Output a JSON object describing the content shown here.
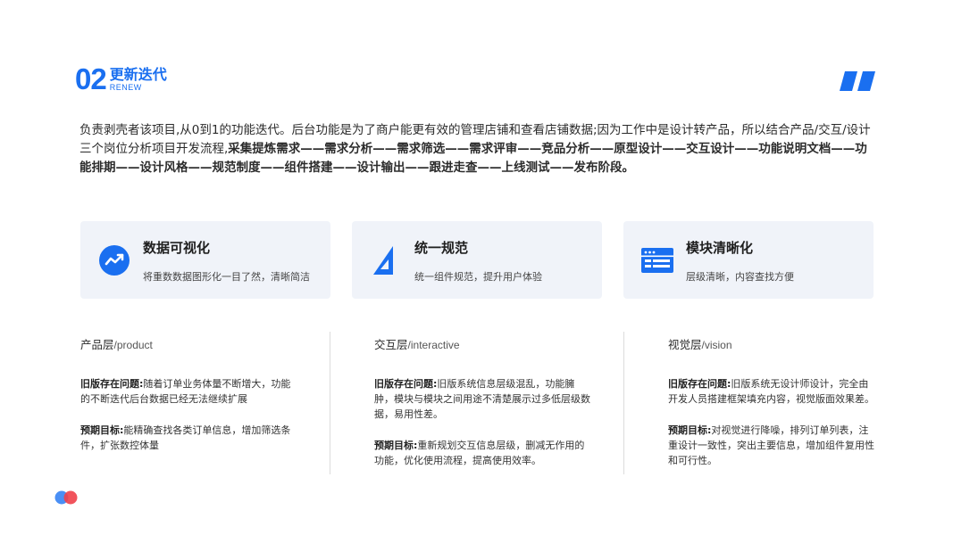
{
  "header": {
    "number": "02",
    "title": "更新迭代",
    "subtitle": "RENEW"
  },
  "intro": {
    "text": "负责剥壳者该项目,从0到1的功能迭代。后台功能是为了商户能更有效的管理店铺和查看店铺数据;因为工作中是设计转产品，所以结合产品/交互/设计三个岗位分析项目开发流程,",
    "flow": "采集提炼需求——需求分析——需求筛选——需求评审——竞品分析——原型设计——交互设计——功能说明文档——功能排期——设计风格——规范制度——组件搭建——设计输出——跟进走查——上线测试——发布阶段。"
  },
  "cards": [
    {
      "title": "数据可视化",
      "desc": "将重数数据图形化一目了然，清晰简洁",
      "icon": "trend-chart-icon"
    },
    {
      "title": "统一规范",
      "desc": "统一组件规范，提升用户体验",
      "icon": "ruler-triangle-icon"
    },
    {
      "title": "模块清晰化",
      "desc": "层级清晰，内容查找方便",
      "icon": "module-layout-icon"
    }
  ],
  "columns": [
    {
      "title_cn": "产品层",
      "title_en": "/product",
      "problem_label": "旧版存在问题:",
      "problem": "随着订单业务体量不断增大，功能的不断迭代后台数据已经无法继续扩展",
      "goal_label": "预期目标:",
      "goal": "能精确查找各类订单信息，增加筛选条件，扩张数控体量"
    },
    {
      "title_cn": "交互层",
      "title_en": "/interactive",
      "problem_label": "旧版存在问题:",
      "problem": "旧版系统信息层级混乱，功能臃肿，模块与模块之间用途不清楚展示过多低层级数据，易用性差。",
      "goal_label": "预期目标:",
      "goal": "重新规划交互信息层级，删减无作用的功能，优化使用流程，提高使用效率。"
    },
    {
      "title_cn": "视觉层",
      "title_en": "/vision",
      "problem_label": "旧版存在问题:",
      "problem": "旧版系统无设计师设计，完全由开发人员搭建框架填充内容，视觉版面效果差。",
      "goal_label": "预期目标:",
      "goal": "对视觉进行降噪，排列订单列表，注重设计一致性，突出主要信息，增加组件复用性和可行性。"
    }
  ],
  "colors": {
    "accent": "#1a6ff0",
    "card_bg": "#f0f3f9",
    "dot_blue": "#4a8ff5",
    "dot_red": "#f0404a"
  }
}
